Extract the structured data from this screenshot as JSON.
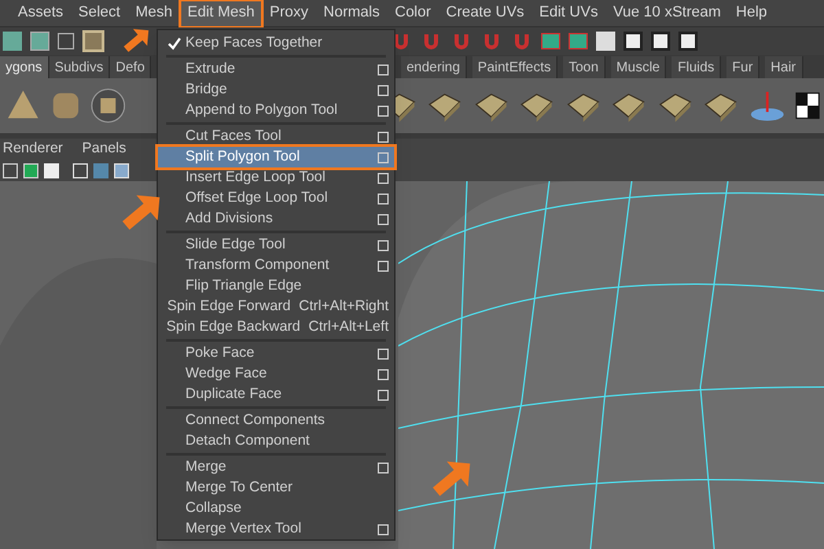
{
  "menubar": [
    {
      "label": "Assets",
      "selected": false
    },
    {
      "label": "Select",
      "selected": false
    },
    {
      "label": "Mesh",
      "selected": false
    },
    {
      "label": "Edit Mesh",
      "selected": true
    },
    {
      "label": "Proxy",
      "selected": false
    },
    {
      "label": "Normals",
      "selected": false
    },
    {
      "label": "Color",
      "selected": false
    },
    {
      "label": "Create UVs",
      "selected": false
    },
    {
      "label": "Edit UVs",
      "selected": false
    },
    {
      "label": "Vue 10 xStream",
      "selected": false
    },
    {
      "label": "Help",
      "selected": false
    }
  ],
  "shelf_tabs_left": [
    {
      "label": "ygons",
      "selected": true
    },
    {
      "label": "Subdivs",
      "selected": false
    },
    {
      "label": "Defo",
      "selected": false
    }
  ],
  "shelf_tabs_right": [
    {
      "label": "endering",
      "selected": false
    },
    {
      "label": "PaintEffects",
      "selected": false
    },
    {
      "label": "Toon",
      "selected": false
    },
    {
      "label": "Muscle",
      "selected": false
    },
    {
      "label": "Fluids",
      "selected": false
    },
    {
      "label": "Fur",
      "selected": false
    },
    {
      "label": "Hair",
      "selected": false
    }
  ],
  "panel_menu": [
    "Renderer",
    "Panels"
  ],
  "edit_menu": {
    "items": [
      {
        "kind": "toggle",
        "label": "Keep Faces Together",
        "checked": true,
        "option_box": false,
        "selected": false
      },
      {
        "kind": "separator"
      },
      {
        "kind": "item",
        "label": "Extrude",
        "option_box": true,
        "selected": false
      },
      {
        "kind": "item",
        "label": "Bridge",
        "option_box": true,
        "selected": false
      },
      {
        "kind": "item",
        "label": "Append to Polygon Tool",
        "option_box": true,
        "selected": false
      },
      {
        "kind": "separator"
      },
      {
        "kind": "item",
        "label": "Cut Faces Tool",
        "option_box": true,
        "selected": false
      },
      {
        "kind": "item",
        "label": "Split Polygon Tool",
        "option_box": true,
        "selected": true
      },
      {
        "kind": "item",
        "label": "Insert Edge Loop Tool",
        "option_box": true,
        "selected": false
      },
      {
        "kind": "item",
        "label": "Offset Edge Loop Tool",
        "option_box": true,
        "selected": false
      },
      {
        "kind": "item",
        "label": "Add Divisions",
        "option_box": true,
        "selected": false
      },
      {
        "kind": "separator"
      },
      {
        "kind": "item",
        "label": "Slide Edge Tool",
        "option_box": true,
        "selected": false
      },
      {
        "kind": "item",
        "label": "Transform Component",
        "option_box": true,
        "selected": false
      },
      {
        "kind": "item",
        "label": "Flip Triangle Edge",
        "option_box": false,
        "selected": false
      },
      {
        "kind": "item",
        "label": "Spin Edge Forward",
        "shortcut": "Ctrl+Alt+Right",
        "option_box": false,
        "selected": false
      },
      {
        "kind": "item",
        "label": "Spin Edge Backward",
        "shortcut": "Ctrl+Alt+Left",
        "option_box": false,
        "selected": false
      },
      {
        "kind": "separator"
      },
      {
        "kind": "item",
        "label": "Poke Face",
        "option_box": true,
        "selected": false
      },
      {
        "kind": "item",
        "label": "Wedge Face",
        "option_box": true,
        "selected": false
      },
      {
        "kind": "item",
        "label": "Duplicate Face",
        "option_box": true,
        "selected": false
      },
      {
        "kind": "separator"
      },
      {
        "kind": "item",
        "label": "Connect Components",
        "option_box": false,
        "selected": false
      },
      {
        "kind": "item",
        "label": "Detach Component",
        "option_box": false,
        "selected": false
      },
      {
        "kind": "separator"
      },
      {
        "kind": "item",
        "label": "Merge",
        "option_box": true,
        "selected": false
      },
      {
        "kind": "item",
        "label": "Merge To Center",
        "option_box": false,
        "selected": false
      },
      {
        "kind": "item",
        "label": "Collapse",
        "option_box": false,
        "selected": false
      },
      {
        "kind": "item",
        "label": "Merge Vertex Tool",
        "option_box": true,
        "selected": false
      }
    ]
  }
}
